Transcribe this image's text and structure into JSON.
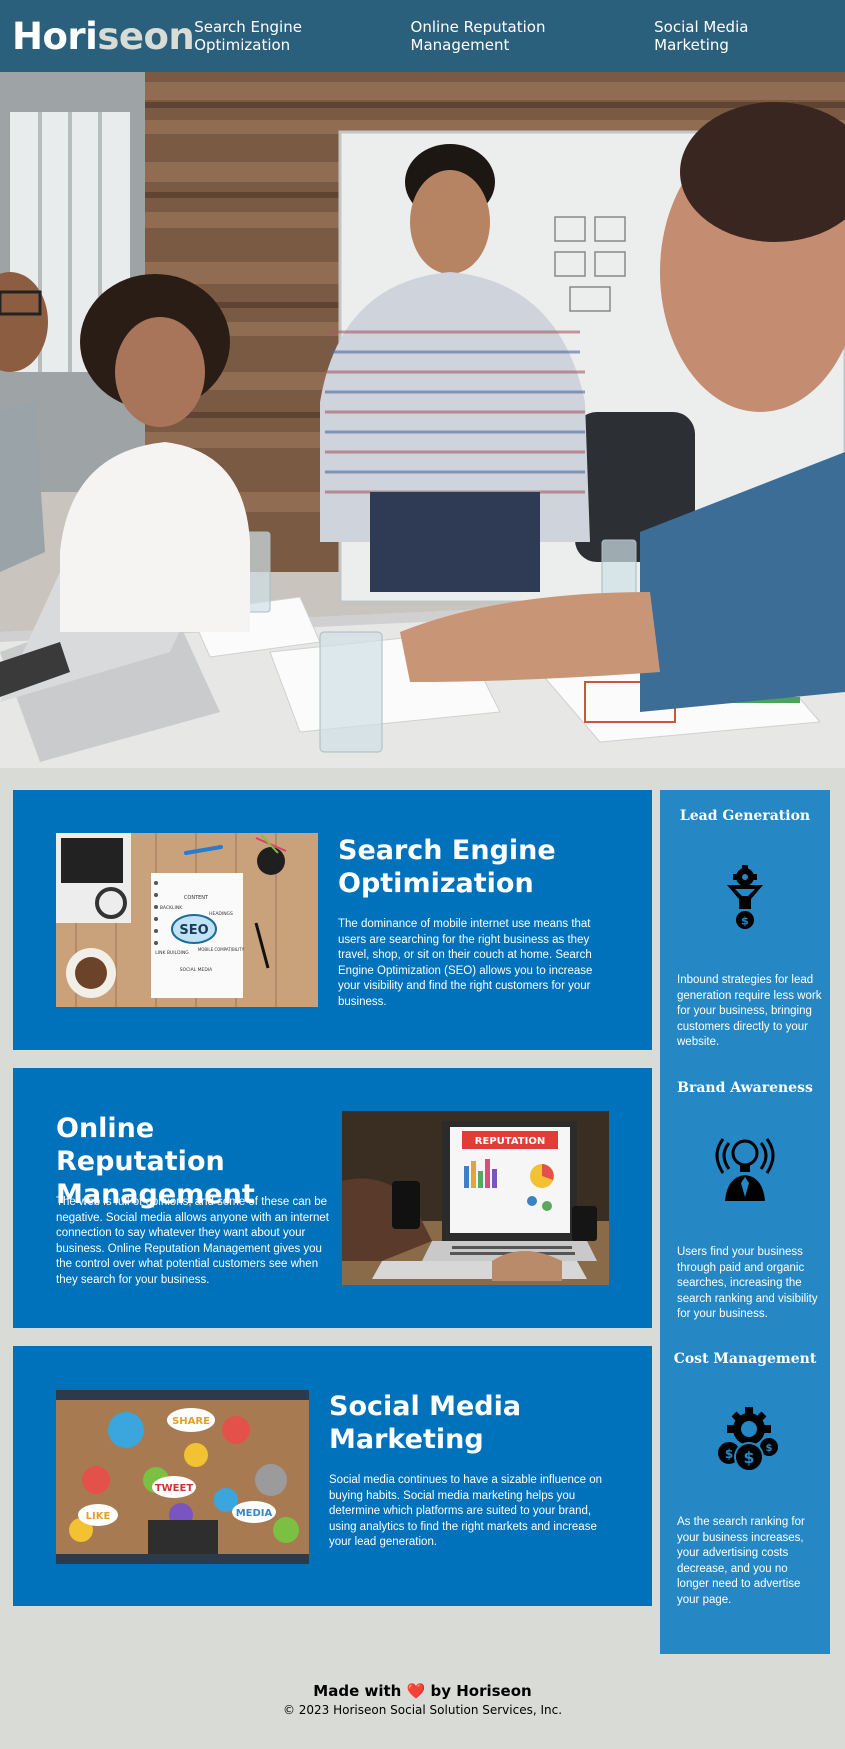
{
  "header": {
    "logo_main": "Hori",
    "logo_accent": "seon",
    "nav": [
      {
        "label": "Search Engine Optimization"
      },
      {
        "label": "Online Reputation Management"
      },
      {
        "label": "Social Media Marketing"
      }
    ]
  },
  "cards": [
    {
      "title": "Search Engine Optimization",
      "text": "The dominance of mobile internet use means that users are searching for the right business as they travel, shop, or sit on their couch at home. Search Engine Optimization (SEO) allows you to increase your visibility and find the right customers for your business.",
      "image_labels": [
        "SEO",
        "CONTENT",
        "HEADINGS",
        "BACKLINK",
        "LINK BUILDING",
        "MOBILE COMPATIBILITY",
        "SOCIAL MEDIA"
      ]
    },
    {
      "title": "Online Reputation Management",
      "text": "The web is full of opinions, and some of these can be negative. Social media allows anyone with an internet connection to say whatever they want about your business. Online Reputation Management gives you the control over what potential customers see when they search for your business.",
      "image_labels": [
        "REPUTATION"
      ]
    },
    {
      "title": "Social Media Marketing",
      "text": "Social media continues to have a sizable influence on buying habits. Social media marketing helps you determine which platforms are suited to your brand, using analytics to find the right markets and increase your lead generation.",
      "image_labels": [
        "SHARE",
        "TWEET",
        "LIKE",
        "MEDIA"
      ]
    }
  ],
  "benefits": [
    {
      "title": "Lead Generation",
      "icon": "funnel-gear-dollar-icon",
      "text": "Inbound strategies for lead generation require less work for your business, bringing customers directly to your website."
    },
    {
      "title": "Brand Awareness",
      "icon": "lightbulb-head-icon",
      "text": "Users find your business through paid and organic searches, increasing the search ranking and visibility for your business."
    },
    {
      "title": "Cost Management",
      "icon": "gear-coins-icon",
      "text": "As the search ranking for your business increases, your advertising costs decrease, and you no longer need to advertise your page."
    }
  ],
  "footer": {
    "made_prefix": "Made with",
    "made_suffix": "by Horiseon",
    "copyright": "© 2023 Horiseon Social Solution Services, Inc."
  },
  "colors": {
    "header_bg": "#2a607c",
    "page_bg": "#d9dcd6",
    "card_bg": "#0072bb",
    "benefits_bg": "#2588c5"
  }
}
